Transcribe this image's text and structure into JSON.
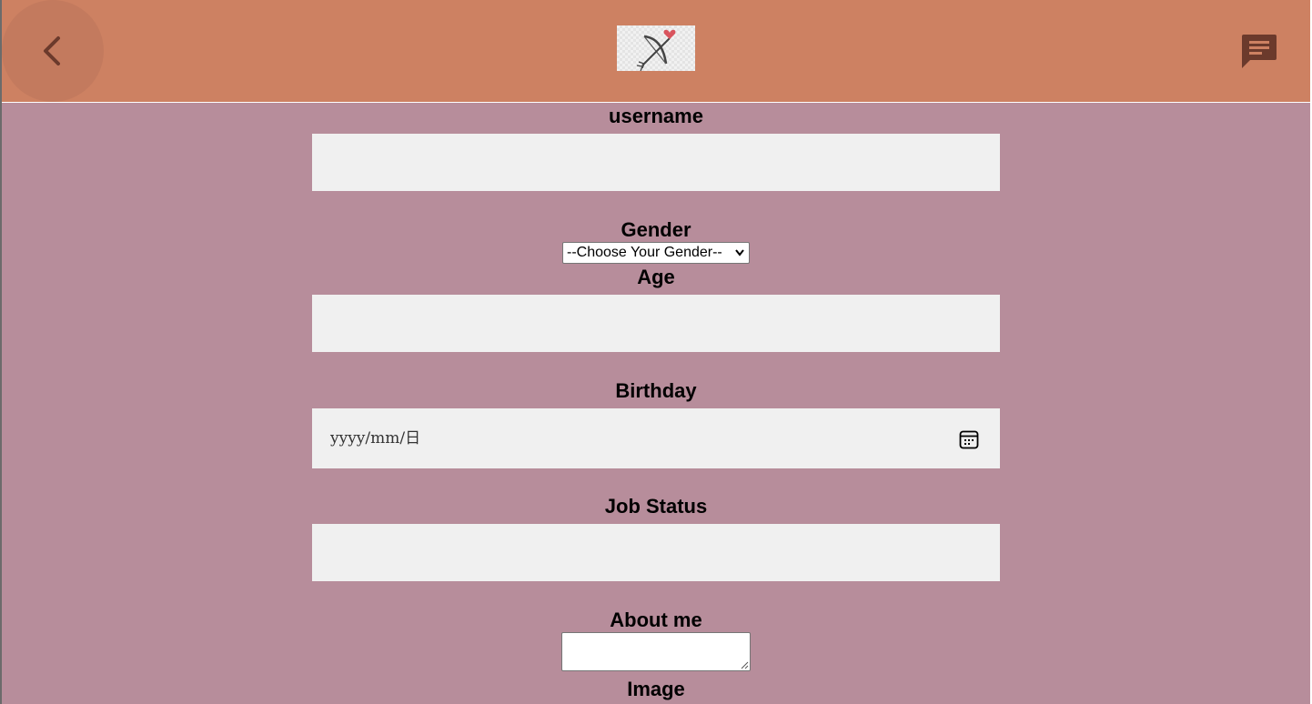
{
  "header": {
    "back_icon": "chevron-left-icon",
    "logo_icon": "bow-and-arrow-heart-icon",
    "chat_icon": "chat-message-icon",
    "colors": {
      "header_bg": "#cd8162",
      "page_bg": "#b78d9b",
      "icon": "#6b3a2c"
    }
  },
  "form": {
    "username": {
      "label": "username",
      "value": ""
    },
    "gender": {
      "label": "Gender",
      "selected": "--Choose Your Gender--"
    },
    "age": {
      "label": "Age",
      "value": ""
    },
    "birthday": {
      "label": "Birthday",
      "placeholder": "yyyy/mm/日",
      "icon": "calendar-icon"
    },
    "job_status": {
      "label": "Job Status",
      "value": ""
    },
    "about_me": {
      "label": "About me",
      "value": ""
    },
    "image": {
      "label": "Image"
    }
  }
}
